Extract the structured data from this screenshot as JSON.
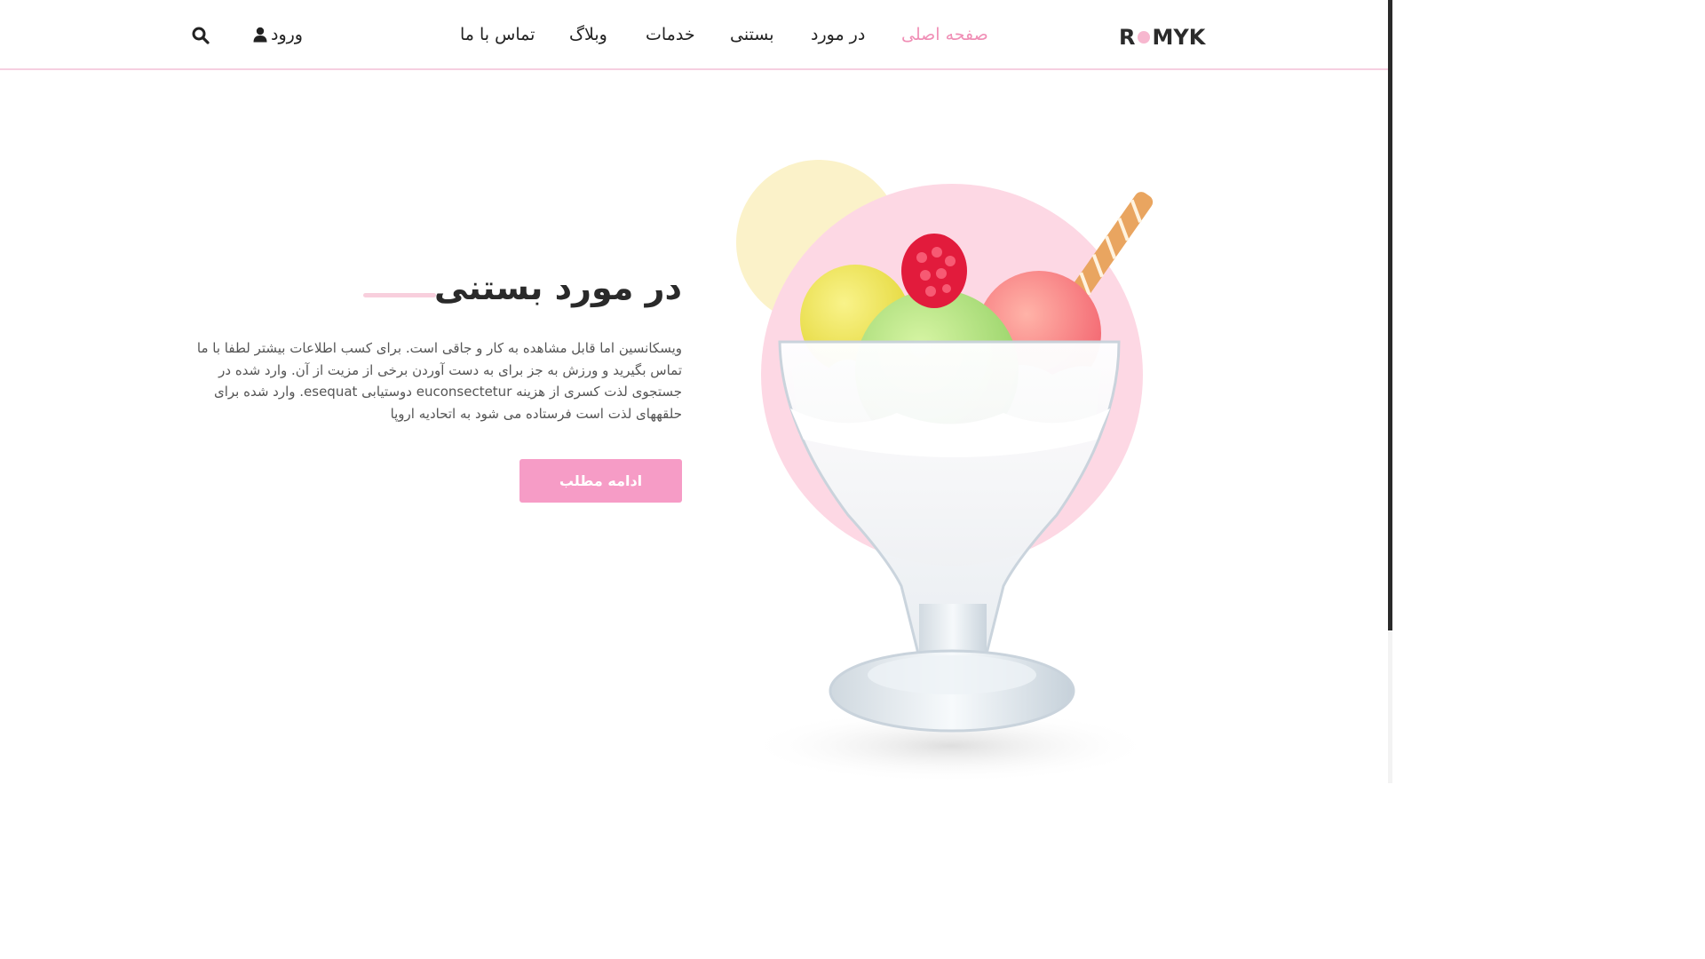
{
  "header": {
    "logo_text_left": "R",
    "logo_text_right": "MYK",
    "nav": [
      {
        "label": "صفحه اصلی",
        "active": true
      },
      {
        "label": "در مورد",
        "active": false
      },
      {
        "label": "بستنی",
        "active": false
      },
      {
        "label": "خدمات",
        "active": false
      },
      {
        "label": "وبلاگ",
        "active": false
      },
      {
        "label": "تماس با ما",
        "active": false
      }
    ],
    "login_label": "ورود",
    "icons": [
      "search-icon",
      "user-icon"
    ]
  },
  "hero": {
    "title": "در مورد بستنی",
    "description": "ویسکانسین اما قابل مشاهده به کار و جاقی است. برای کسب اطلاعات بیشتر لطفا با ما تماس بگیرید و ورزش به جز برای به دست آوردن برخی از مزیت از آن. وارد شده در جستجوی لذت کسری از هزینه euconsectetur دوستیابی esequat. وارد شده برای حلقههای لذت است فرستاده می شود به اتحادیه اروپا",
    "button_label": "ادامه مطلب"
  },
  "colors": {
    "accent_pink": "#f69cc6",
    "active_nav": "#f08fb6",
    "circle_pink": "#fdd8e4",
    "circle_yellow": "#fbf2c9",
    "title_underline": "#f8cfdd"
  }
}
